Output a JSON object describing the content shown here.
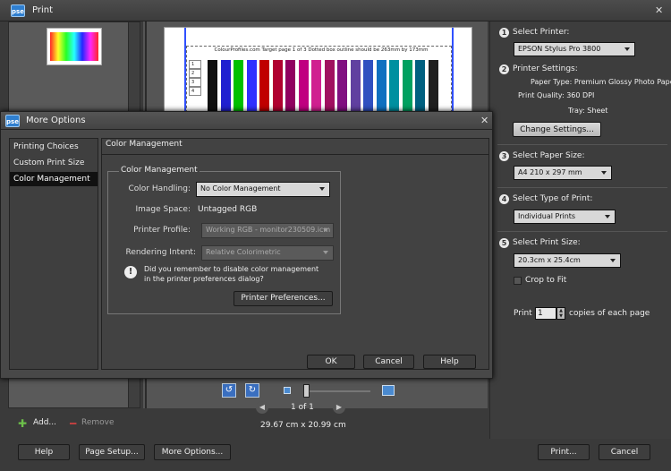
{
  "window": {
    "app_badge": "pse",
    "title": "Print"
  },
  "left_panel": {
    "add_label": "Add...",
    "remove_label": "Remove"
  },
  "preview": {
    "header_text": "ColourProfiles.com    Target page 1 of 3    Dotted box outline should be 263mm by 173mm",
    "row_labels": [
      "1",
      "2",
      "3",
      "4"
    ],
    "swatch_colors": [
      "#101010",
      "#2020d0",
      "#00c000",
      "#3030ff",
      "#c00000",
      "#b00030",
      "#900060",
      "#c00080",
      "#d02090",
      "#a01060",
      "#801080",
      "#6040a0",
      "#3050c0",
      "#1070c0",
      "#0090a0",
      "#00a060",
      "#006080",
      "#202020"
    ],
    "page_indicator": "1 of 1",
    "paper_dimensions": "29.67 cm x 20.99 cm"
  },
  "right_panel": {
    "select_printer": {
      "number": "1",
      "label": "Select Printer:",
      "value": "EPSON Stylus Pro 3800"
    },
    "printer_settings": {
      "number": "2",
      "label": "Printer Settings:",
      "paper_type": "Paper Type:  Premium Glossy Photo Paper",
      "print_quality": "Print Quality:  360 DPI",
      "tray": "Tray:  Sheet",
      "change_button": "Change Settings..."
    },
    "paper_size": {
      "number": "3",
      "label": "Select Paper Size:",
      "value": "A4 210 x 297 mm"
    },
    "type_of_print": {
      "number": "4",
      "label": "Select Type of Print:",
      "value": "Individual Prints"
    },
    "print_size": {
      "number": "5",
      "label": "Select Print Size:",
      "value": "20.3cm x 25.4cm",
      "crop_label": "Crop to Fit"
    },
    "copies": {
      "prefix": "Print",
      "value": "1",
      "suffix": "copies of each page"
    }
  },
  "bottom_buttons": {
    "help": "Help",
    "page_setup": "Page Setup...",
    "more_options": "More Options...",
    "print": "Print...",
    "cancel": "Cancel"
  },
  "dialog": {
    "badge": "pse",
    "title": "More Options",
    "nav": [
      "Printing Choices",
      "Custom Print Size",
      "Color Management"
    ],
    "pane_heading": "Color Management",
    "group_title": "Color Management",
    "color_handling_label": "Color Handling:",
    "color_handling_value": "No Color Management",
    "image_space_label": "Image Space:",
    "image_space_value": "Untagged RGB",
    "printer_profile_label": "Printer Profile:",
    "printer_profile_value": "Working RGB - monitor230509.icm",
    "rendering_intent_label": "Rendering Intent:",
    "rendering_intent_value": "Relative Colorimetric",
    "reminder_line1": "Did you remember to disable color management",
    "reminder_line2": "in the printer preferences dialog?",
    "printer_prefs_button": "Printer Preferences...",
    "ok_button": "OK",
    "cancel_button": "Cancel",
    "help_button": "Help"
  }
}
